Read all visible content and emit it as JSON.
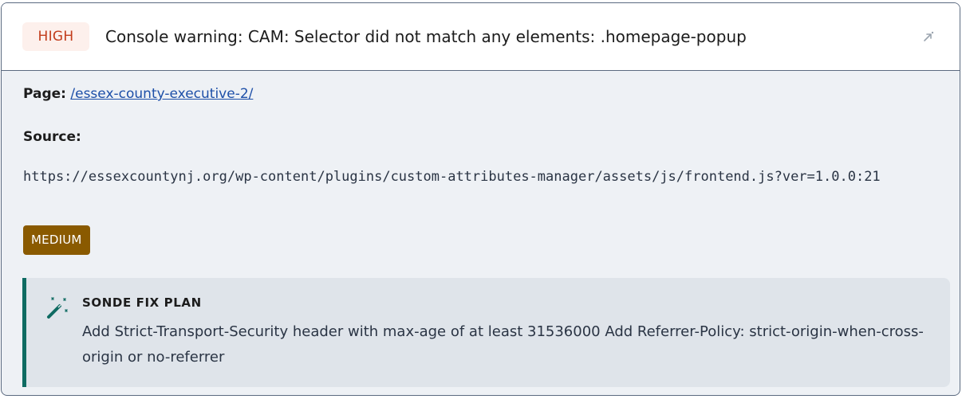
{
  "issue": {
    "severity": "HIGH",
    "title": "Console warning: CAM: Selector did not match any elements: .homepage-popup",
    "expand_icon": "arrow-expand-icon"
  },
  "details": {
    "page_label": "Page:",
    "page_path": "/essex-county-executive-2/",
    "source_label": "Source:",
    "source_url": "https://essexcountynj.org/wp-content/plugins/custom-attributes-manager/assets/js/frontend.js?ver=1.0.0:21",
    "priority": "MEDIUM"
  },
  "fix_plan": {
    "icon": "magic-wand-icon",
    "title": "SONDE FIX PLAN",
    "text": "Add Strict-Transport-Security header with max-age of at least 31536000 Add Referrer-Policy: strict-origin-when-cross-origin or no-referrer"
  },
  "colors": {
    "high_text": "#c23d1c",
    "high_bg": "#fdf0ec",
    "medium_bg": "#8a5a00",
    "fix_accent": "#0f6b62",
    "link": "#1d4fa8"
  }
}
